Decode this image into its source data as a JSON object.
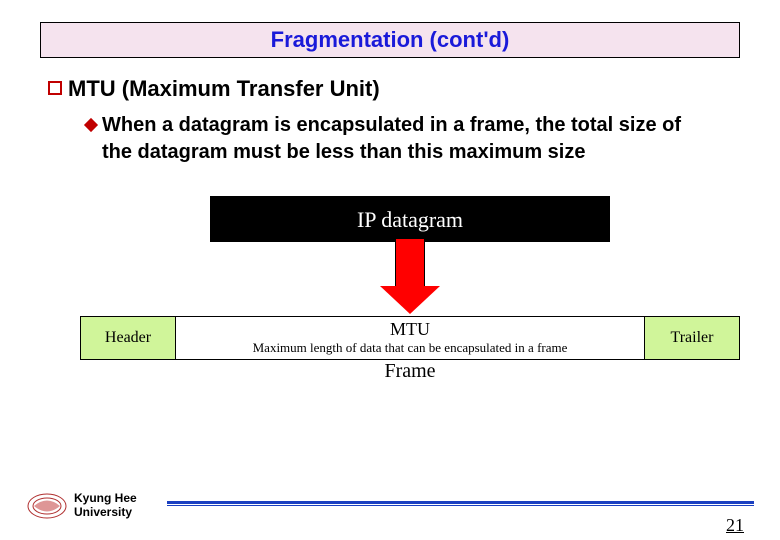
{
  "title": "Fragmentation (cont'd)",
  "bullet1": "MTU (Maximum Transfer Unit)",
  "bullet2": "When a datagram is encapsulated in a frame, the total size of the datagram must be less than this maximum size",
  "diagram": {
    "ip_label": "IP datagram",
    "header": "Header",
    "mtu_title": "MTU",
    "mtu_sub": "Maximum length of data that can be encapsulated in a frame",
    "trailer": "Trailer",
    "frame_label": "Frame"
  },
  "footer": {
    "university_line1": "Kyung Hee",
    "university_line2": "University",
    "page_number": "21"
  }
}
